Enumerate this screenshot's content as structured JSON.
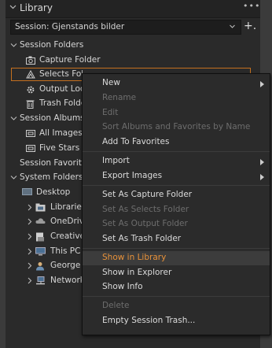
{
  "header": {
    "title": "Library",
    "more": "•••"
  },
  "session": {
    "label": "Session: Gjenstands bilder",
    "add": "+."
  },
  "tree": {
    "session_folders": {
      "title": "Session Folders",
      "items": [
        "Capture Folder",
        "Selects Folder",
        "Output Location",
        "Trash Folder"
      ]
    },
    "session_albums": {
      "title": "Session Albums",
      "items": [
        "All Images",
        "Five Stars"
      ]
    },
    "session_favorites": {
      "title": "Session Favorites"
    },
    "system_folders": {
      "title": "System Folders",
      "items": [
        "Desktop",
        "Libraries",
        "OneDrive",
        "Creative Cloud Files",
        "This PC",
        "George A",
        "Network"
      ]
    }
  },
  "context_menu": {
    "items": [
      {
        "label": "New",
        "enabled": true,
        "submenu": true
      },
      {
        "label": "Rename",
        "enabled": false
      },
      {
        "label": "Edit",
        "enabled": false
      },
      {
        "label": "Sort Albums and Favorites by Name",
        "enabled": false
      },
      {
        "label": "Add To Favorites",
        "enabled": true
      },
      {
        "label": "Import",
        "enabled": true,
        "submenu": true
      },
      {
        "label": "Export Images",
        "enabled": true,
        "submenu": true
      },
      {
        "label": "Set As Capture Folder",
        "enabled": true
      },
      {
        "label": "Set As Selects Folder",
        "enabled": false
      },
      {
        "label": "Set As Output Folder",
        "enabled": false
      },
      {
        "label": "Set As Trash Folder",
        "enabled": true
      },
      {
        "label": "Show in Library",
        "enabled": true,
        "highlighted": true
      },
      {
        "label": "Show in Explorer",
        "enabled": true
      },
      {
        "label": "Show Info",
        "enabled": true
      },
      {
        "label": "Delete",
        "enabled": false
      },
      {
        "label": "Empty Session Trash...",
        "enabled": true
      }
    ]
  },
  "colors": {
    "accent": "#e8923a",
    "selection_border": "#c4701f",
    "panel_bg": "#2a2a2a"
  }
}
